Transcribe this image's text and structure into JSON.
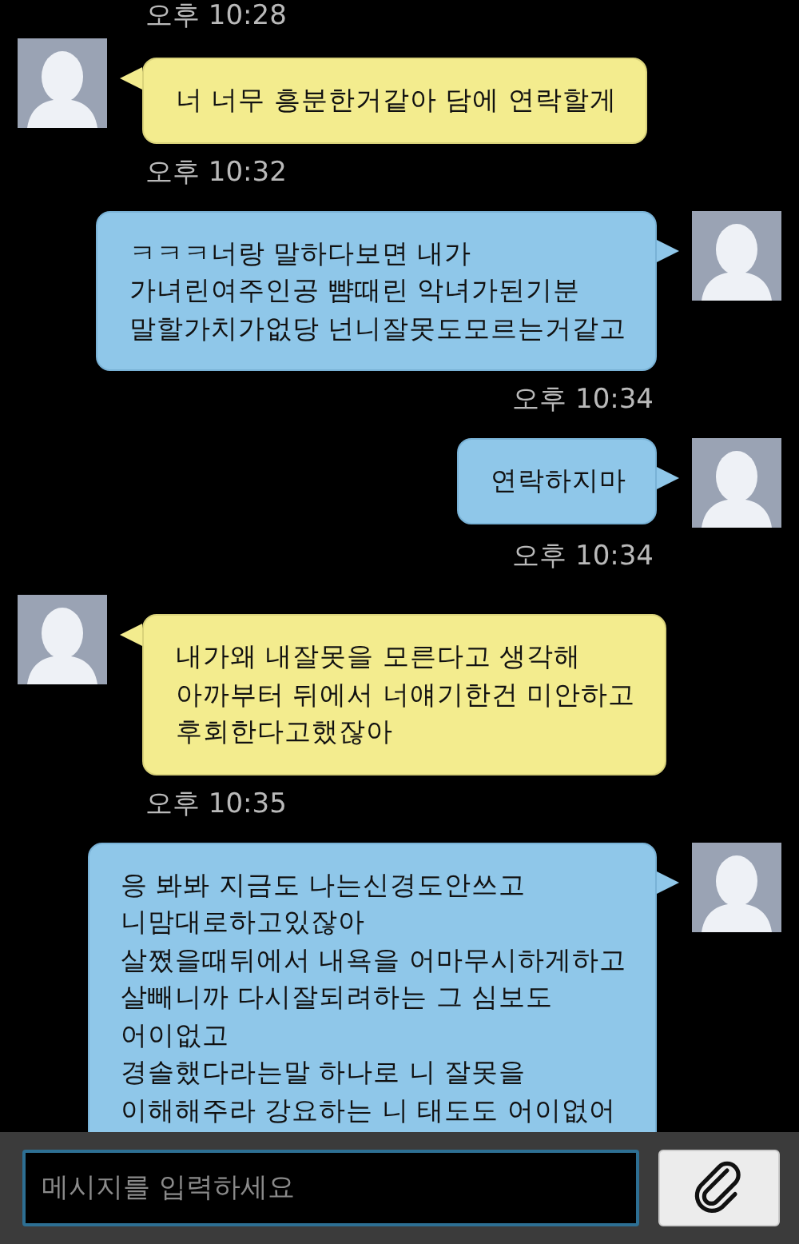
{
  "top_time": "오후 10:28",
  "messages": [
    {
      "kind": "incoming",
      "lines": [
        "너 너무 흥분한거같아 담에 연락할게"
      ],
      "time": "오후 10:32"
    },
    {
      "kind": "outgoing",
      "lines": [
        "ㅋㅋㅋ너랑 말하다보면 내가",
        "가녀린여주인공 뺨때린 악녀가된기분",
        "말할가치가없당 넌니잘못도모르는거같고"
      ],
      "time": "오후 10:34"
    },
    {
      "kind": "outgoing",
      "lines": [
        "연락하지마"
      ],
      "time": "오후 10:34"
    },
    {
      "kind": "incoming",
      "lines": [
        "내가왜 내잘못을 모른다고 생각해",
        "아까부터 뒤에서 너얘기한건 미안하고",
        "후회한다고했잖아"
      ],
      "time": "오후 10:35"
    },
    {
      "kind": "outgoing",
      "lines": [
        "응 봐봐 지금도 나는신경도안쓰고",
        "니맘대로하고있잖아",
        "살쪘을때뒤에서 내욕을 어마무시하게하고",
        "살빼니까 다시잘되려하는 그 심보도",
        "어이없고",
        "경솔했다라는말 하나로 니 잘못을",
        "이해해주라 강요하는 니 태도도 어이없어"
      ]
    }
  ],
  "composer": {
    "placeholder": "메시지를 입력하세요"
  }
}
